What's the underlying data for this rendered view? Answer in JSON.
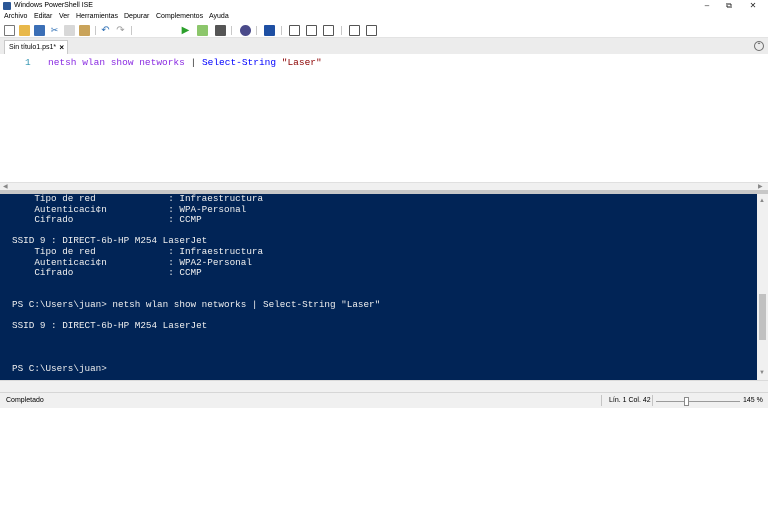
{
  "window": {
    "title": "Windows PowerShell ISE",
    "controls": [
      "minimize-icon",
      "restore-icon",
      "close-icon"
    ]
  },
  "menu": [
    "Archivo",
    "Editar",
    "Ver",
    "Herramientas",
    "Depurar",
    "Complementos",
    "Ayuda"
  ],
  "toolbar": {
    "icons": [
      "new-file-icon",
      "open-folder-icon",
      "save-icon",
      "cut-icon",
      "copy-icon",
      "paste-icon",
      "undo-icon",
      "redo-icon",
      "run-icon",
      "run-selection-icon",
      "stop-icon",
      "remote-powershell-icon",
      "start-powershell-icon",
      "show-script-pane-top-icon",
      "show-script-pane-right-icon",
      "show-script-pane-maximized-icon",
      "show-command-window-icon",
      "show-command-addon-icon"
    ]
  },
  "tab": {
    "label": "Sin título1.ps1*",
    "close": "×"
  },
  "script": {
    "line_number": "1",
    "tokens": {
      "cmd": "netsh",
      "args": " wlan show networks ",
      "pipe": "| ",
      "cmdlet": "Select-String",
      "str": " \"Laser\""
    }
  },
  "console": {
    "lines": [
      "    Tipo de red             : Infraestructura",
      "    Autenticaci¢n           : WPA-Personal",
      "    Cifrado                 : CCMP",
      "",
      "SSID 9 : DIRECT-6b-HP M254 LaserJet",
      "    Tipo de red             : Infraestructura",
      "    Autenticaci¢n           : WPA2-Personal",
      "    Cifrado                 : CCMP",
      "",
      "",
      "PS C:\\Users\\juan> netsh wlan show networks | Select-String \"Laser\"",
      "",
      "SSID 9 : DIRECT-6b-HP M254 LaserJet",
      "",
      "",
      "",
      "PS C:\\Users\\juan>"
    ]
  },
  "status": {
    "text": "Completado",
    "position": "Lín. 1  Col. 42",
    "zoom": "145 %"
  },
  "colors": {
    "console_bg": "#012456",
    "console_fg": "#f0f0f0",
    "cmd_purple": "#8a2be2",
    "cmdlet_blue": "#0000ff",
    "string_darkred": "#8b0000"
  }
}
